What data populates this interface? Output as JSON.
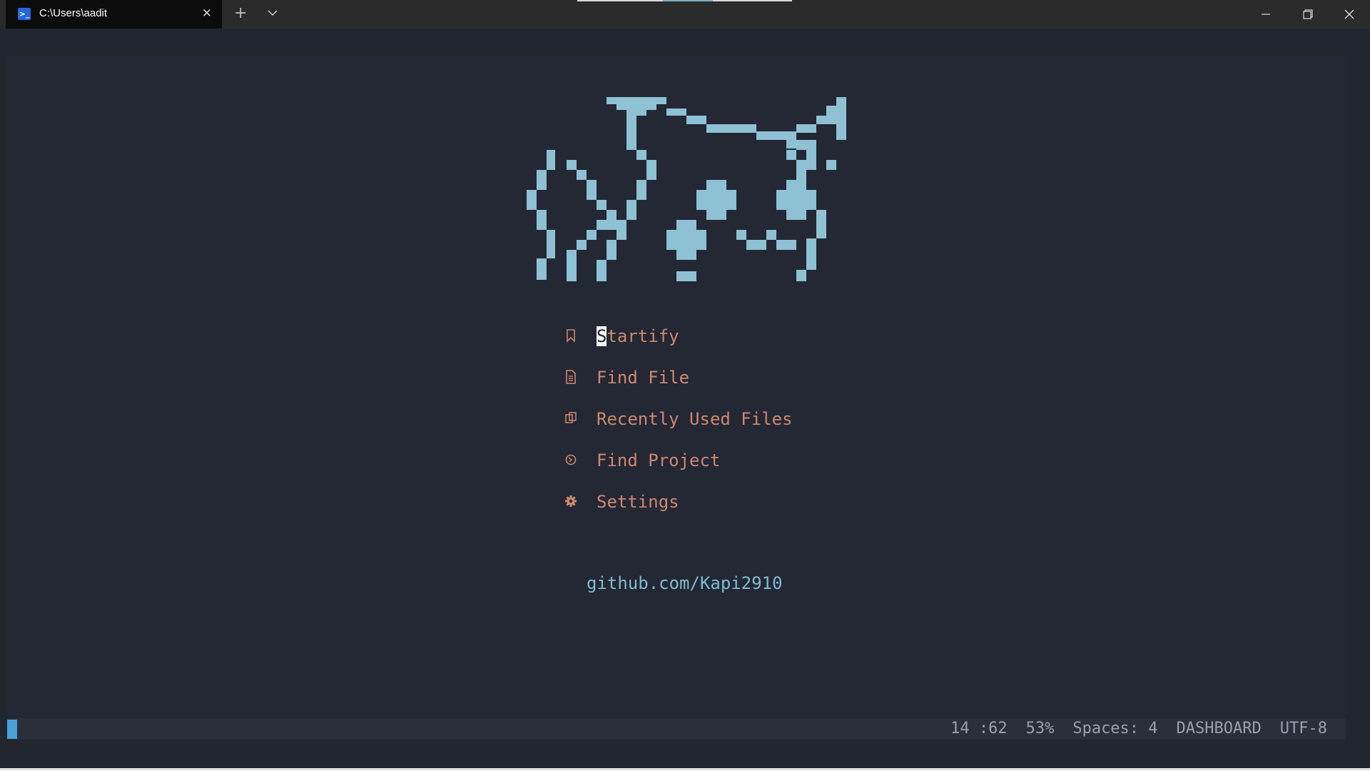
{
  "window": {
    "tab_title": "C:\\Users\\aadit",
    "tab_icon": "powershell-icon",
    "shell_glyph": ">_"
  },
  "dashboard": {
    "menu": [
      {
        "icon": "bookmark-icon",
        "label_cursor": "S",
        "label_rest": "tartify"
      },
      {
        "icon": "file-icon",
        "label": "Find File"
      },
      {
        "icon": "files-icon",
        "label": "Recently Used Files"
      },
      {
        "icon": "project-icon",
        "label": "Find Project"
      },
      {
        "icon": "gear-icon",
        "label": "Settings"
      }
    ],
    "footer": "github.com/Kapi2910"
  },
  "statusline": {
    "position": "14 :62",
    "percent": "53%",
    "indent": "Spaces: 4",
    "filetype": "DASHBOARD",
    "encoding": "UTF-8"
  },
  "colors": {
    "logo": "#8ec1d3",
    "menu": "#d0876f",
    "link": "#7fbcd1",
    "background": "#232834",
    "status_fg": "#9aa0ad",
    "mode_accent": "#4aa0d8"
  }
}
